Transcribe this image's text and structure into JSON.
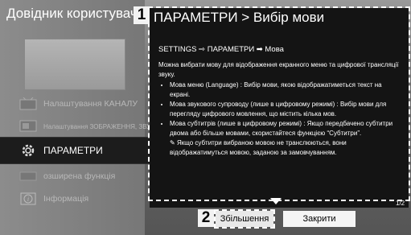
{
  "left": {
    "title": "Довідник користувача",
    "menu": [
      {
        "label": "Налаштування КАНАЛУ",
        "icon": "tv-antenna-icon"
      },
      {
        "label": "Налаштування ЗОБРАЖЕННЯ, ЗВУКУ",
        "icon": "tv-picture-icon"
      },
      {
        "label": "ПАРАМЕТРИ",
        "icon": "gear-icon"
      },
      {
        "label": "озширена функція",
        "icon": "extended-function-icon"
      },
      {
        "label": "Інформація",
        "icon": "info-icon"
      }
    ]
  },
  "badges": {
    "one": "1",
    "two": "2"
  },
  "dialog": {
    "title": "ПАРАМЕТРИ > Вибір мови",
    "breadcrumb": "SETTINGS ⇨ ПАРАМЕТРИ ➡ Мова",
    "intro": "Можна вибрати мову для відображення екранного меню та цифрової трансляції звуку.",
    "options": [
      "Мова меню (Language) : Вибір мови, якою відображатиметься текст на екрані.",
      "Мова звукового супроводу (лише в цифровому режимі) : Вибір мови для перегляду цифрового мовлення, що містить кілька мов.",
      "Мова субтитрів (лише в цифровому режимі) : Якщо передбачено субтитри двома або більше мовами, скористайтеся функцією “Субтитри”."
    ],
    "note": "Якщо субтитри вибраною мовою не транслюються, вони відображатимуться мовою, заданою за замовчуванням.",
    "page": "1/2"
  },
  "buttons": {
    "zoom": "Збільшення",
    "close": "Закрити"
  }
}
